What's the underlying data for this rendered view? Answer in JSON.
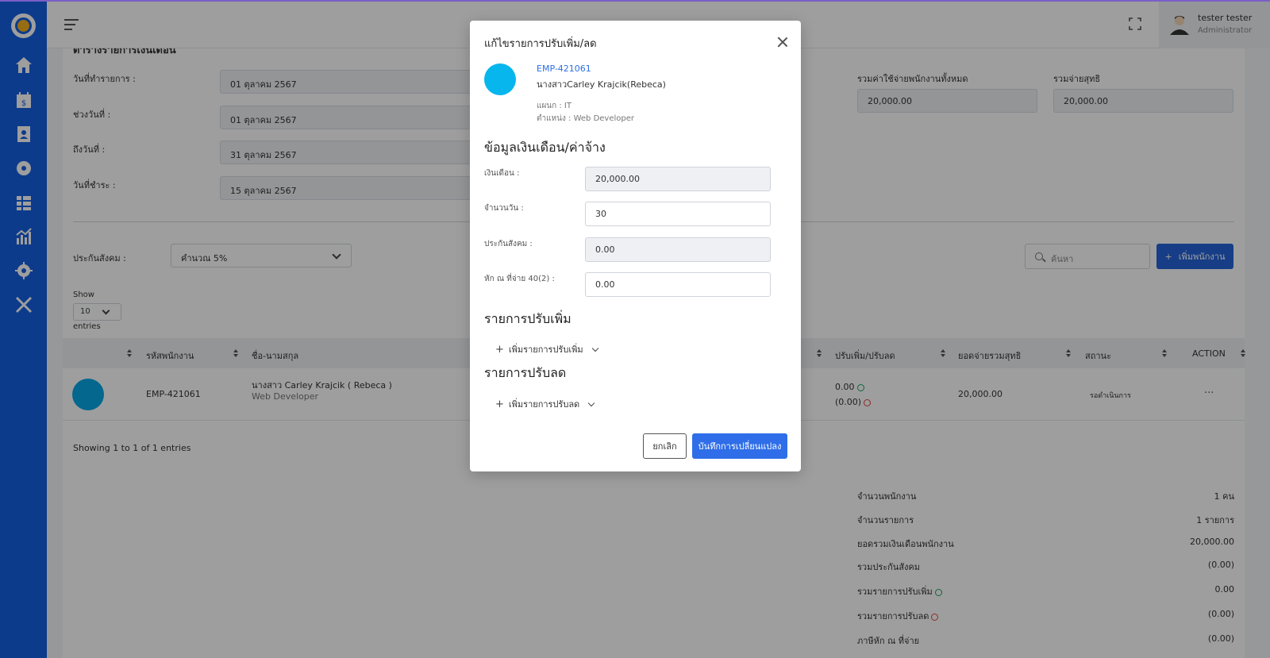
{
  "header": {
    "user_name": "tester tester",
    "user_role": "Administrator"
  },
  "page": {
    "heading": "ตารางรายการเงินเดือน",
    "fields": {
      "doc_date_label": "วันที่ทำรายการ :",
      "doc_date": "01 ตุลาคม 2567",
      "range_label": "ช่วงวันที่ :",
      "range_from": "01 ตุลาคม 2567",
      "to_label": "ถึงวันที่ :",
      "range_to": "31 ตุลาคม 2567",
      "pay_label": "วันที่ชำระ :",
      "pay_date": "15 ตุลาคม 2567",
      "total_cost_label": "รวมค่าใช้จ่ายพนักงานทั้งหมด",
      "total_cost": "20,000.00",
      "net_label": "รวมจ่ายสุทธิ",
      "net": "20,000.00"
    },
    "social_label": "ประกันสังคม :",
    "social_select": "คำนวณ 5%",
    "search_placeholder": "ค้นหา",
    "add_employee": "เพิ่มพนักงาน",
    "show_label": "Show",
    "show_value": "10",
    "entries_label": "entries",
    "table": {
      "headers": [
        "รหัสพนักงาน",
        "ชื่อ-นามสกุล",
        "ปรับเพิ่ม/ปรับลด",
        "ยอดจ่ายรวมสุทธิ",
        "สถานะ",
        "ACTION"
      ],
      "row": {
        "code": "EMP-421061",
        "name": "นางสาว Carley Krajcik ( Rebeca )",
        "position": "Web Developer",
        "adj_plus": "0.00",
        "adj_minus": "(0.00)",
        "net": "20,000.00",
        "status": "รอดำเนินการ",
        "action": "···"
      }
    },
    "showing": "Showing 1 to 1 of 1 entries",
    "summary": [
      {
        "label": "จำนวนพนักงาน",
        "value": "1 คน"
      },
      {
        "label": "จำนวนรายการ",
        "value": "1 รายการ"
      },
      {
        "label": "ยอดรวมเงินเดือนพนักงาน",
        "value": "20,000.00"
      },
      {
        "label": "รวมประกันสังคม",
        "value": "(0.00)"
      },
      {
        "label": "รวมรายการปรับเพิ่ม",
        "value": "0.00"
      },
      {
        "label": "รวมรายการปรับลด",
        "value": "(0.00)"
      },
      {
        "label": "ภาษีหัก ณ ที่จ่าย",
        "value": "(0.00)"
      }
    ]
  },
  "modal": {
    "title": "แก้ไขรายการปรับเพิ่ม/ลด",
    "emp_code": "EMP-421061",
    "emp_name": "นางสาวCarley Krajcik(Rebeca)",
    "dept": "แผนก : IT",
    "position": "ตำแหน่ง : Web Developer",
    "salary_section": "ข้อมูลเงินเดือน/ค่าจ้าง",
    "salary_label": "เงินเดือน :",
    "salary": "20,000.00",
    "days_label": "จำนวนวัน :",
    "days": "30",
    "social_label": "ประกันสังคม :",
    "social": "0.00",
    "tax_label": "หัก ณ ที่จ่าย 40(2) :",
    "tax": "0.00",
    "plus_section": "รายการปรับเพิ่ม",
    "plus_add": "เพิ่มรายการปรับเพิ่ม",
    "minus_section": "รายการปรับลด",
    "minus_add": "เพิ่มรายการปรับลด",
    "cancel": "ยกเลิก",
    "save": "บันทึกการเปลี่ยนแปลง"
  },
  "colors": {
    "sidebar": "#1660e0",
    "primary_button": "#2f6ee8",
    "link": "#2d6fe0",
    "avatar": "#08b6ee"
  }
}
